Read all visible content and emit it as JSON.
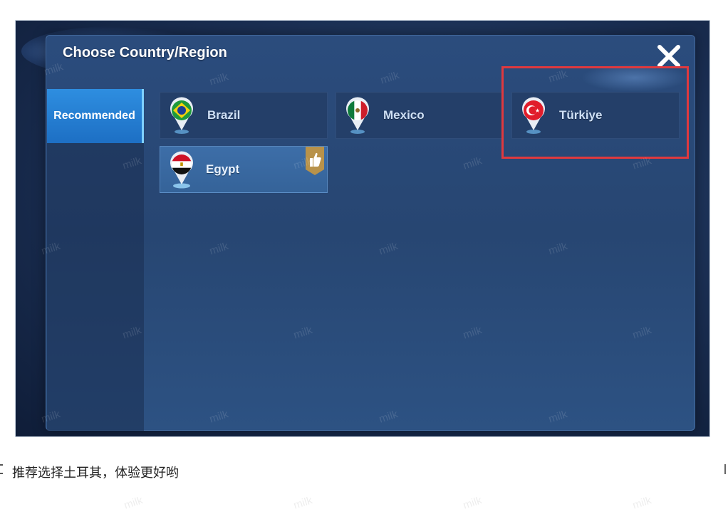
{
  "dialog": {
    "title": "Choose Country/Region",
    "close_icon": "close-icon"
  },
  "sidebar": {
    "tabs": [
      {
        "label": "Recommended",
        "active": true
      }
    ]
  },
  "regions": [
    {
      "label": "Brazil",
      "flag": "brazil-flag-icon",
      "selected": false
    },
    {
      "label": "Mexico",
      "flag": "mexico-flag-icon",
      "selected": false
    },
    {
      "label": "Türkiye",
      "flag": "turkiye-flag-icon",
      "selected": false,
      "highlighted": true
    },
    {
      "label": "Egypt",
      "flag": "egypt-flag-icon",
      "selected": true,
      "badge": "thumbs-up-icon"
    }
  ],
  "caption": {
    "text": "推荐选择土耳其，体验更好哟"
  },
  "watermark": {
    "text": "milk"
  },
  "colors": {
    "highlight": "#e0393e",
    "active_tab": "#2e8ee0",
    "panel_bg": "#274672"
  }
}
